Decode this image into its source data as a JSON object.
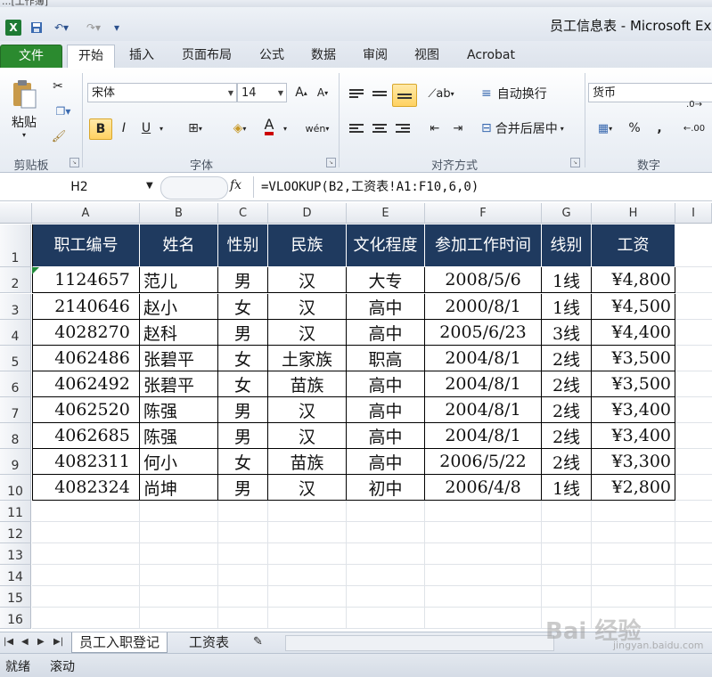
{
  "window": {
    "top_strip_text": "...[工作簿]",
    "title": "员工信息表 - Microsoft Ex",
    "qat_icons": [
      "excel-logo-icon",
      "save-icon",
      "undo-icon",
      "redo-icon",
      "customize-qat-icon"
    ]
  },
  "ribbon_tabs": [
    "文件",
    "开始",
    "插入",
    "页面布局",
    "公式",
    "数据",
    "审阅",
    "视图",
    "Acrobat"
  ],
  "active_tab": "开始",
  "ribbon": {
    "clipboard": {
      "label": "剪贴板",
      "paste": "粘贴"
    },
    "font": {
      "label": "字体",
      "family": "宋体",
      "size": "14",
      "bold": "B",
      "italic": "I",
      "underline": "U",
      "font_color": "#cc0000"
    },
    "alignment": {
      "label": "对齐方式",
      "wrap": "自动换行",
      "merge": "合并后居中"
    },
    "number": {
      "label": "数字",
      "format": "货币",
      "percent": "%",
      "comma": ","
    }
  },
  "formula_bar": {
    "name_box": "H2",
    "fx": "fx",
    "formula": "=VLOOKUP(B2,工资表!A1:F10,6,0)"
  },
  "columns": [
    "A",
    "B",
    "C",
    "D",
    "E",
    "F",
    "G",
    "H",
    "I"
  ],
  "rows": [
    "1",
    "2",
    "3",
    "4",
    "5",
    "6",
    "7",
    "8",
    "9",
    "10",
    "11",
    "12",
    "13",
    "14",
    "15",
    "16"
  ],
  "table": {
    "headers": [
      "职工编号",
      "姓名",
      "性别",
      "民族",
      "文化程度",
      "参加工作时间",
      "线别",
      "工资"
    ],
    "rows": [
      [
        "1124657",
        "范儿",
        "男",
        "汉",
        "大专",
        "2008/5/6",
        "1线",
        "¥4,800"
      ],
      [
        "2140646",
        "赵小",
        "女",
        "汉",
        "高中",
        "2000/8/1",
        "1线",
        "¥4,500"
      ],
      [
        "4028270",
        "赵科",
        "男",
        "汉",
        "高中",
        "2005/6/23",
        "3线",
        "¥4,400"
      ],
      [
        "4062486",
        "张碧平",
        "女",
        "土家族",
        "职高",
        "2004/8/1",
        "2线",
        "¥3,500"
      ],
      [
        "4062492",
        "张碧平",
        "女",
        "苗族",
        "高中",
        "2004/8/1",
        "2线",
        "¥3,500"
      ],
      [
        "4062520",
        "陈强",
        "男",
        "汉",
        "高中",
        "2004/8/1",
        "2线",
        "¥3,400"
      ],
      [
        "4062685",
        "陈强",
        "男",
        "汉",
        "高中",
        "2004/8/1",
        "2线",
        "¥3,400"
      ],
      [
        "4082311",
        "何小",
        "女",
        "苗族",
        "高中",
        "2006/5/22",
        "2线",
        "¥3,300"
      ],
      [
        "4082324",
        "尚坤",
        "男",
        "汉",
        "初中",
        "2006/4/8",
        "1线",
        "¥2,800"
      ]
    ]
  },
  "sheets": [
    "员工入职登记",
    "工资表"
  ],
  "active_sheet": "员工入职登记",
  "status": {
    "ready": "就绪",
    "scroll": "滚动"
  },
  "watermark": {
    "brand": "Bai 经验",
    "url": "jingyan.baidu.com"
  },
  "colors": {
    "header_fill": "#1f3a5f",
    "file_tab": "#2b8a2f",
    "selected_button": "#ffd262"
  }
}
